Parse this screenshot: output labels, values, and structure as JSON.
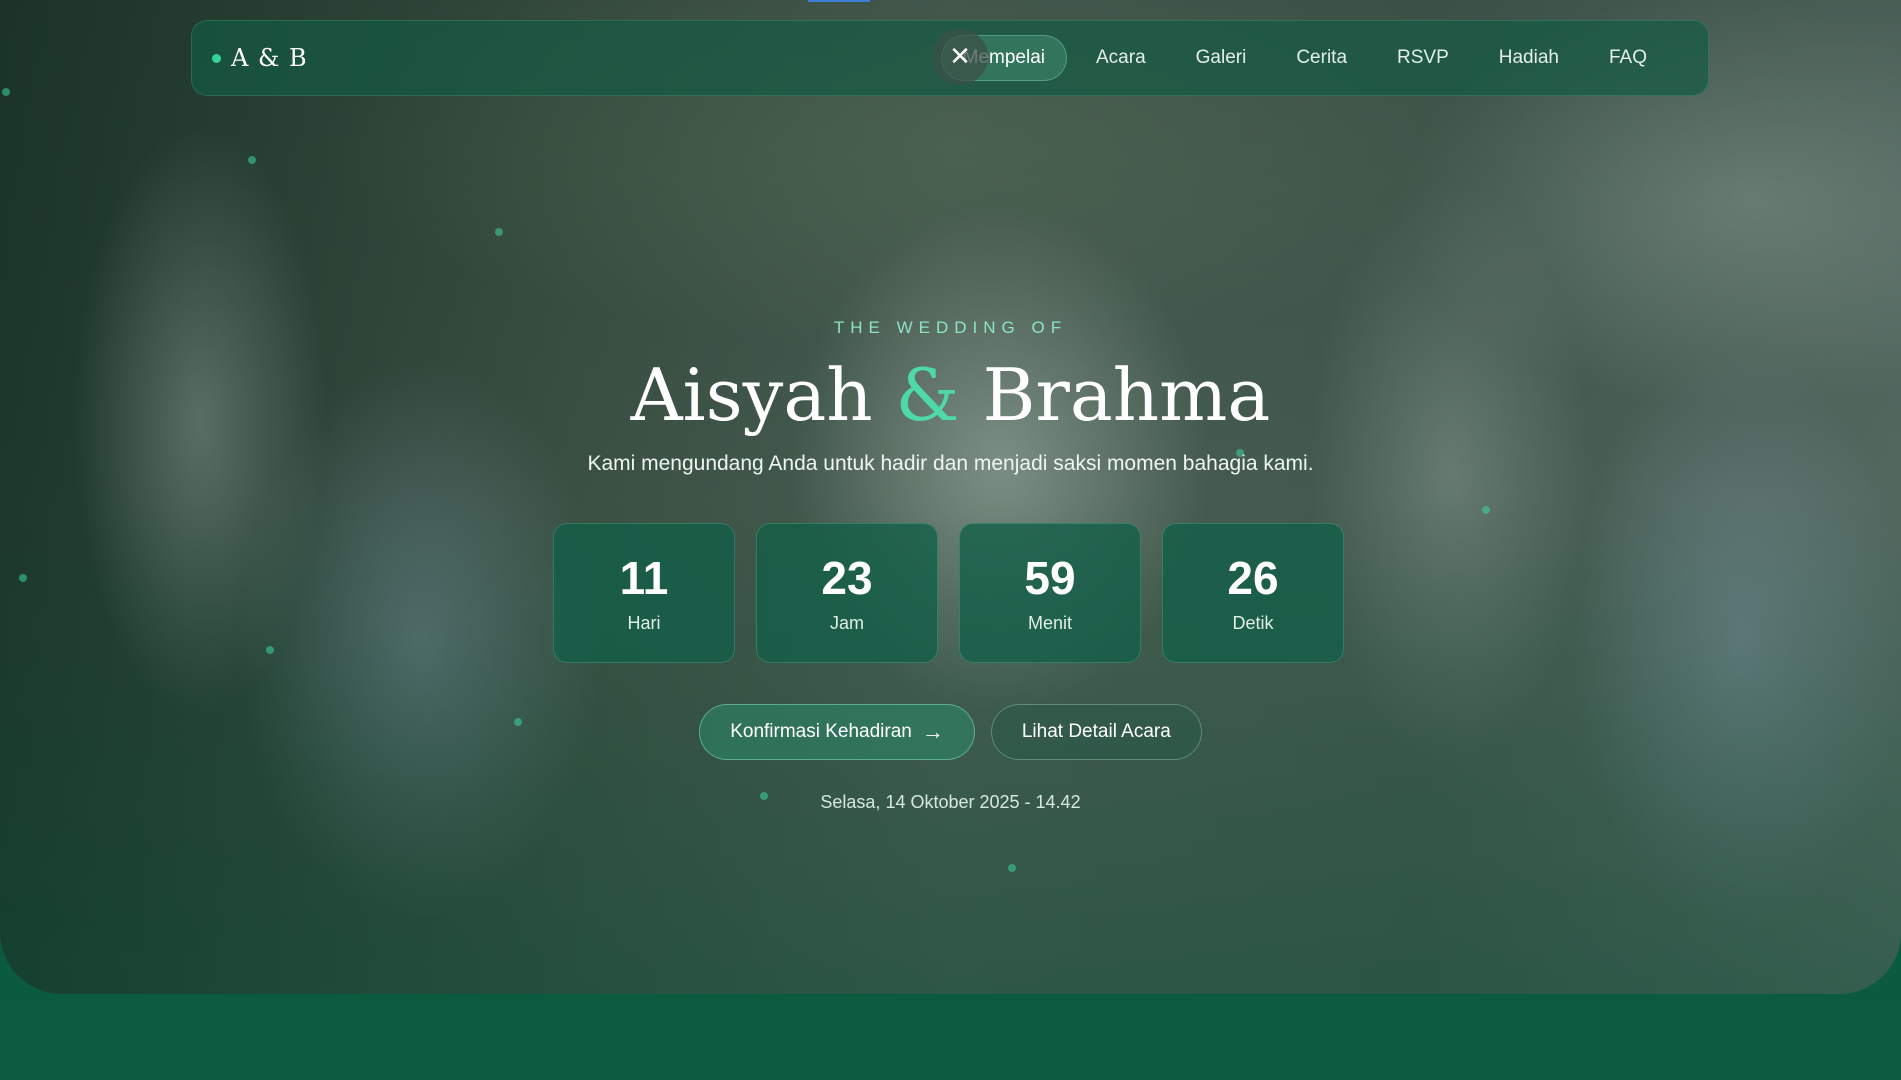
{
  "brand": {
    "text": "A & B"
  },
  "nav": {
    "items": [
      "Mempelai",
      "Acara",
      "Galeri",
      "Cerita",
      "RSVP",
      "Hadiah",
      "FAQ"
    ],
    "active": "Mempelai"
  },
  "overlay": {
    "close_icon": "close-icon"
  },
  "hero": {
    "eyebrow": "THE WEDDING OF",
    "name_left": "Aisyah",
    "ampersand": "&",
    "name_right": "Brahma",
    "subtitle": "Kami mengundang Anda untuk hadir dan menjadi saksi momen bahagia kami."
  },
  "countdown": [
    {
      "value": "11",
      "label": "Hari"
    },
    {
      "value": "23",
      "label": "Jam"
    },
    {
      "value": "59",
      "label": "Menit"
    },
    {
      "value": "26",
      "label": "Detik"
    }
  ],
  "buttons": {
    "rsvp_label": "Konfirmasi Kehadiran",
    "rsvp_arrow": "→",
    "detail_label": "Lihat Detail Acara"
  },
  "event_date": "Selasa, 14 Oktober 2025 - 14.42",
  "colors": {
    "accent": "#4fd8a8",
    "primary": "#0a5a3e"
  }
}
